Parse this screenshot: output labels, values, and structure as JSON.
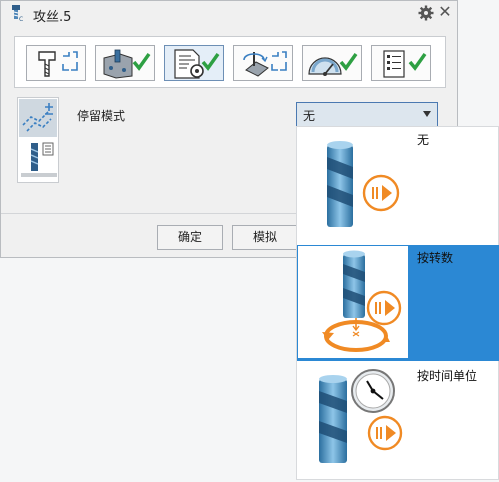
{
  "window": {
    "title": "攻丝.5",
    "icon": "tap-tool-icon"
  },
  "toolbar": {
    "buttons": [
      {
        "name": "tool-setup-button",
        "icon": "tap-tool-icon",
        "status": "pending"
      },
      {
        "name": "geometry-button",
        "icon": "part-geometry-icon",
        "status": "done"
      },
      {
        "name": "strategy-button",
        "icon": "strategy-settings-icon",
        "status": "done",
        "active": true
      },
      {
        "name": "feeds-speeds-button",
        "icon": "feed-rate-icon",
        "status": "pending"
      },
      {
        "name": "macros-button",
        "icon": "speedometer-icon",
        "status": "done"
      },
      {
        "name": "checklist-button",
        "icon": "checklist-icon",
        "status": "done"
      }
    ]
  },
  "side": {
    "items": [
      {
        "name": "dwell-mode-tab",
        "icon": "dwell-path-icon",
        "selected": true
      },
      {
        "name": "tap-params-tab",
        "icon": "tap-params-icon",
        "selected": false
      }
    ]
  },
  "form": {
    "dwell_label": "停留模式",
    "dwell_value": "无"
  },
  "footer": {
    "ok_label": "确定",
    "simulate_label": "模拟"
  },
  "dropdown": {
    "options": [
      {
        "label": "无",
        "icon": "tap-no-dwell-icon",
        "highlighted": false
      },
      {
        "label": "按转数",
        "icon": "tap-dwell-revolutions-icon",
        "highlighted": true
      },
      {
        "label": "按时间单位",
        "icon": "tap-dwell-time-icon",
        "highlighted": false
      }
    ]
  },
  "colors": {
    "accent": "#2b88d4",
    "check": "#2ea043",
    "orange": "#f08a24",
    "tap_blue": "#3f8fc6"
  }
}
